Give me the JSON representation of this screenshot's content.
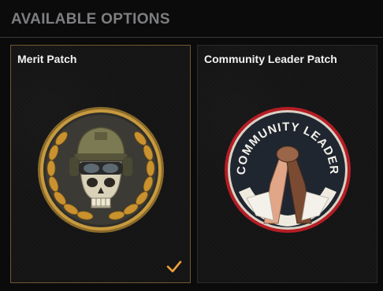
{
  "header": {
    "title": "AVAILABLE OPTIONS"
  },
  "options": [
    {
      "label": "Merit Patch",
      "selected": true
    },
    {
      "label": "Community Leader Patch",
      "selected": false,
      "patch_text": "COMMUNITY LEADER"
    }
  ],
  "colors": {
    "accent": "#f0a13a",
    "selected_border": "#6e5a2c",
    "header_text": "#7d7e80"
  }
}
